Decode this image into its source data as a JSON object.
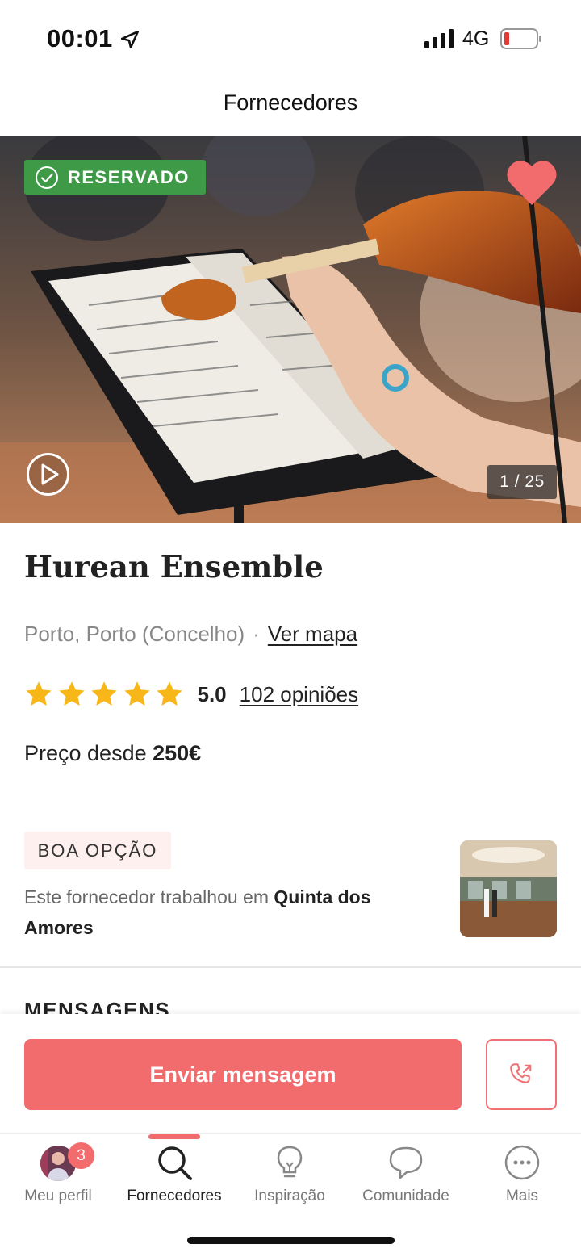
{
  "status_bar": {
    "time": "00:01",
    "network": "4G",
    "icons": [
      "location-arrow-icon",
      "signal-icon",
      "battery-low-icon"
    ]
  },
  "header": {
    "title": "Fornecedores"
  },
  "hero": {
    "badge": "RESERVADO",
    "photo_counter": "1 / 25",
    "icons": [
      "check-circle-icon",
      "heart-icon",
      "play-icon"
    ],
    "colors": {
      "badge": "#3f9a48",
      "heart": "#f26c6e"
    }
  },
  "vendor": {
    "name": "Hurean Ensemble",
    "location": "Porto, Porto (Concelho)",
    "separator": "·",
    "map_link": "Ver mapa",
    "rating": "5.0",
    "rating_stars": 5,
    "reviews": "102 opiniões",
    "price_prefix": "Preço desde",
    "price_value": "250€"
  },
  "good_option": {
    "badge": "BOA OPÇÃO",
    "text_prefix": "Este fornecedor trabalhou em",
    "venue": "Quinta dos Amores"
  },
  "messages": {
    "heading": "MENSAGENS"
  },
  "actions": {
    "send_label": "Enviar mensagem",
    "accent_color": "#f26c6e"
  },
  "tab_bar": {
    "items": [
      {
        "label": "Meu perfil",
        "badge": "3"
      },
      {
        "label": "Fornecedores"
      },
      {
        "label": "Inspiração"
      },
      {
        "label": "Comunidade"
      },
      {
        "label": "Mais"
      }
    ],
    "active_index": 1
  }
}
